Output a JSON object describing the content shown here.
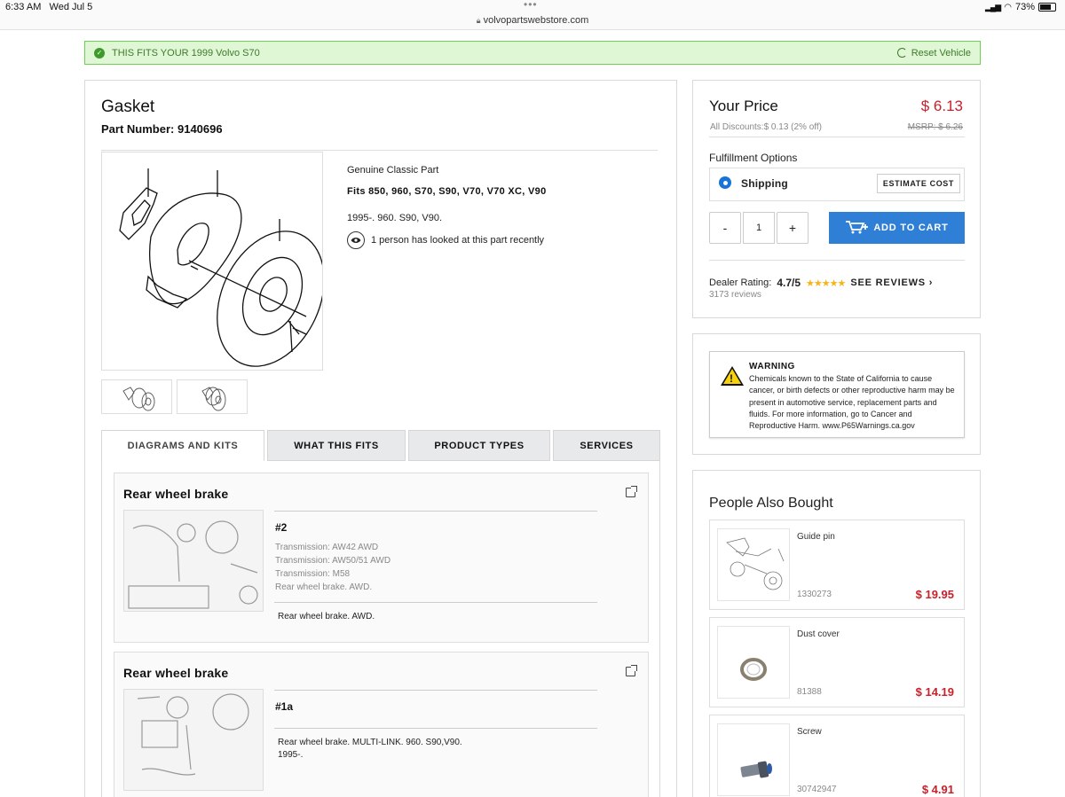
{
  "status_bar": {
    "time": "6:33 AM",
    "date": "Wed Jul 5",
    "url": "volvopartswebstore.com",
    "battery": "73%",
    "battery_level": 0.73
  },
  "fits_banner": {
    "prefix": "THIS FITS YOUR",
    "vehicle": "1999 Volvo S70",
    "reset_label": "Reset Vehicle"
  },
  "product": {
    "title": "Gasket",
    "part_number_label": "Part Number:",
    "part_number": "9140696",
    "genuine": "Genuine Classic Part",
    "fits": "Fits 850, 960, S70, S90, V70, V70 XC, V90",
    "years": "1995-. 960. S90, V90.",
    "looked": "1 person has looked at this part recently"
  },
  "tabs": [
    {
      "label": "DIAGRAMS AND KITS",
      "active": true
    },
    {
      "label": "WHAT THIS FITS",
      "active": false
    },
    {
      "label": "PRODUCT TYPES",
      "active": false
    },
    {
      "label": "SERVICES",
      "active": false
    }
  ],
  "diagrams": [
    {
      "title": "Rear wheel brake",
      "number": "#2",
      "specs": [
        "Transmission: AW42 AWD",
        "Transmission: AW50/51 AWD",
        "Transmission: M58",
        "Rear wheel brake. AWD."
      ],
      "note": [
        "Rear wheel brake. AWD."
      ]
    },
    {
      "title": "Rear wheel brake",
      "number": "#1a",
      "specs": [],
      "note": [
        "Rear wheel brake. MULTI-LINK. 960. S90,V90.",
        "1995-."
      ]
    }
  ],
  "price": {
    "your_price_label": "Your Price",
    "price": "$ 6.13",
    "discounts": "All Discounts:$ 0.13 (2% off)",
    "msrp": "MSRP: $ 6.26",
    "fulfillment_label": "Fulfillment Options",
    "shipping_label": "Shipping",
    "estimate_label": "ESTIMATE COST",
    "minus": "-",
    "quantity": "1",
    "plus": "+",
    "add_to_cart": "ADD TO CART",
    "rating_label": "Dealer Rating:",
    "rating_value": "4.7/5",
    "stars": "★★★★★",
    "see_reviews": "SEE REVIEWS ›",
    "reviews_count": "3173 reviews"
  },
  "warning": {
    "title": "WARNING",
    "text": "Chemicals known to the State of California to cause cancer, or birth defects or other reproductive harm may be present in automotive service, replacement parts and fluids. For more information, go to Cancer and Reproductive Harm. www.P65Warnings.ca.gov"
  },
  "people_also_bought": {
    "title": "People Also Bought",
    "items": [
      {
        "name": "Guide pin",
        "part_number": "1330273",
        "price": "$ 19.95"
      },
      {
        "name": "Dust cover",
        "part_number": "81388",
        "price": "$ 14.19"
      },
      {
        "name": "Screw",
        "part_number": "30742947",
        "price": "$ 4.91"
      }
    ]
  },
  "colors": {
    "accent_blue": "#2e7fd5",
    "price_red": "#c9202a",
    "fits_green": "#dff7d4",
    "star_gold": "#f4b41a"
  }
}
